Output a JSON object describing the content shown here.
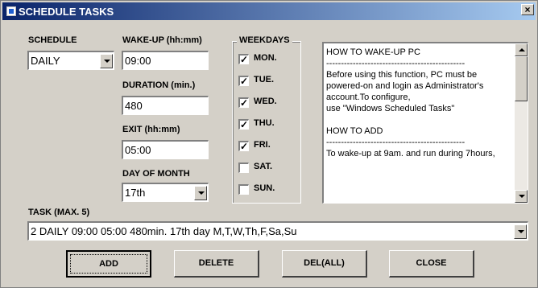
{
  "window": {
    "title": "SCHEDULE TASKS",
    "close_label": "×"
  },
  "schedule": {
    "label": "SCHEDULE",
    "value": "DAILY"
  },
  "wakeup": {
    "label": "WAKE-UP (hh:mm)",
    "value": "09:00"
  },
  "duration": {
    "label": "DURATION (min.)",
    "value": "480"
  },
  "exit": {
    "label": "EXIT (hh:mm)",
    "value": "05:00"
  },
  "day_of_month": {
    "label": "DAY OF MONTH",
    "value": "17th"
  },
  "weekdays": {
    "label": "WEEKDAYS",
    "days": [
      {
        "label": "MON.",
        "checked": true,
        "mark": "✓"
      },
      {
        "label": "TUE.",
        "checked": true,
        "mark": "✓"
      },
      {
        "label": "WED.",
        "checked": true,
        "mark": "✓"
      },
      {
        "label": "THU.",
        "checked": true,
        "mark": "✓"
      },
      {
        "label": "FRI.",
        "checked": true,
        "mark": "✓"
      },
      {
        "label": "SAT.",
        "checked": false,
        "mark": ""
      },
      {
        "label": "SUN.",
        "checked": false,
        "mark": ""
      }
    ]
  },
  "help": {
    "text": "HOW TO WAKE-UP PC\n-----------------------------------------------\nBefore using this function, PC must be powered-on and login as Administrator's account.To configure,\nuse \"Windows Scheduled Tasks\"\n\nHOW TO ADD\n-----------------------------------------------\nTo wake-up at 9am. and run during 7hours,"
  },
  "task": {
    "label": "TASK (MAX. 5)",
    "value": "2   DAILY 09:00 05:00 480min. 17th day M,T,W,Th,F,Sa,Su"
  },
  "buttons": {
    "add": "ADD",
    "delete": "DELETE",
    "del_all": "DEL(ALL)",
    "close": "CLOSE"
  }
}
